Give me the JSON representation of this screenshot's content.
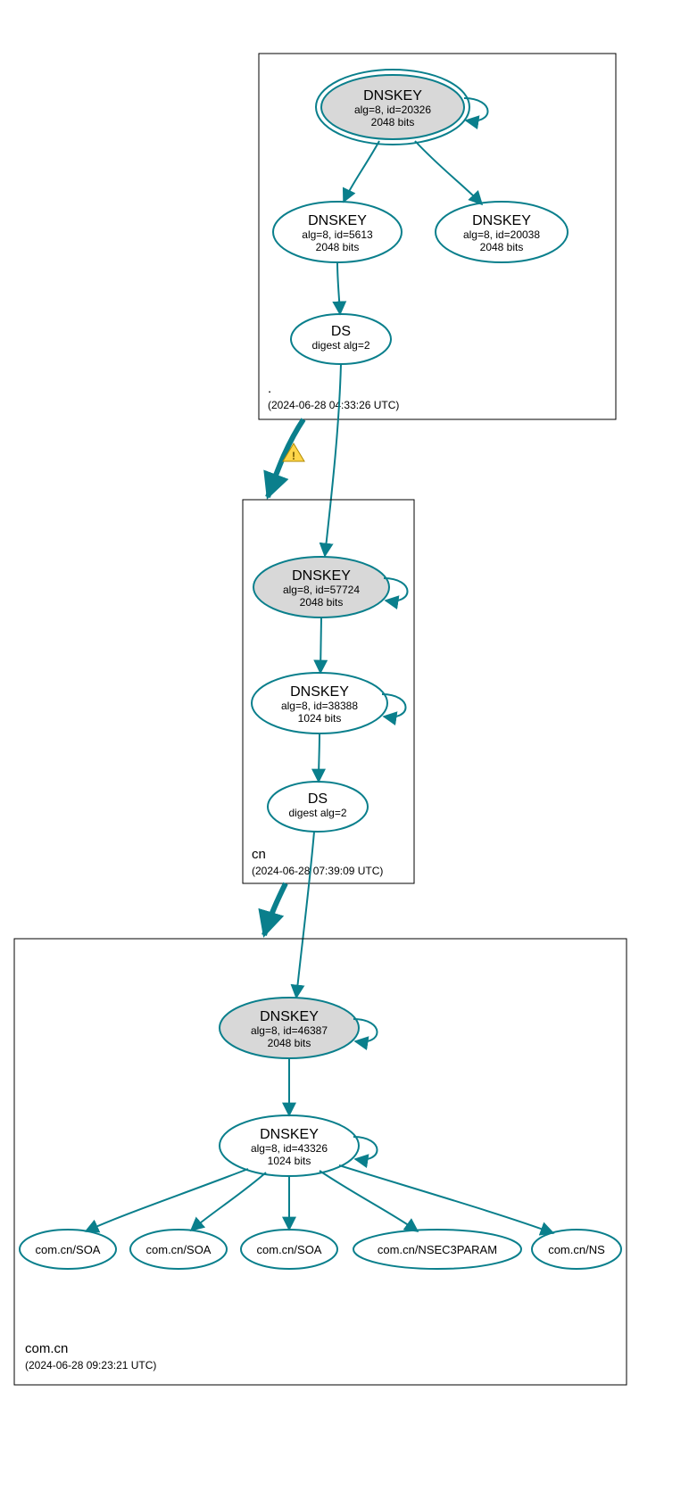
{
  "colors": {
    "stroke": "#0a7f8c",
    "key_fill_grey": "#d8d8d8"
  },
  "zones": {
    "root": {
      "name": ".",
      "timestamp": "(2024-06-28 04:33:26 UTC)",
      "ksk": {
        "title": "DNSKEY",
        "line1": "alg=8, id=20326",
        "line2": "2048 bits"
      },
      "zsk": {
        "title": "DNSKEY",
        "line1": "alg=8, id=5613",
        "line2": "2048 bits"
      },
      "zsk2": {
        "title": "DNSKEY",
        "line1": "alg=8, id=20038",
        "line2": "2048 bits"
      },
      "ds": {
        "title": "DS",
        "line1": "digest alg=2"
      }
    },
    "cn": {
      "name": "cn",
      "timestamp": "(2024-06-28 07:39:09 UTC)",
      "ksk": {
        "title": "DNSKEY",
        "line1": "alg=8, id=57724",
        "line2": "2048 bits"
      },
      "zsk": {
        "title": "DNSKEY",
        "line1": "alg=8, id=38388",
        "line2": "1024 bits"
      },
      "ds": {
        "title": "DS",
        "line1": "digest alg=2"
      }
    },
    "comcn": {
      "name": "com.cn",
      "timestamp": "(2024-06-28 09:23:21 UTC)",
      "ksk": {
        "title": "DNSKEY",
        "line1": "alg=8, id=46387",
        "line2": "2048 bits"
      },
      "zsk": {
        "title": "DNSKEY",
        "line1": "alg=8, id=43326",
        "line2": "1024 bits"
      },
      "rr": {
        "a": "com.cn/SOA",
        "b": "com.cn/SOA",
        "c": "com.cn/SOA",
        "d": "com.cn/NSEC3PARAM",
        "e": "com.cn/NS"
      }
    }
  }
}
